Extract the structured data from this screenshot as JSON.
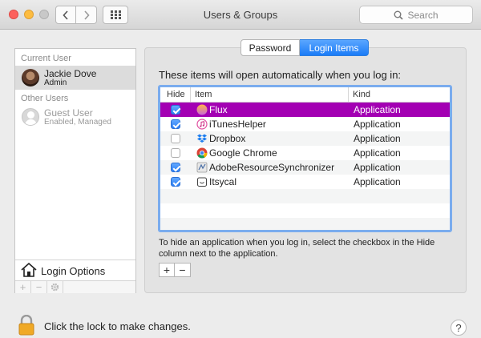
{
  "window": {
    "title": "Users & Groups"
  },
  "toolbar": {
    "search_placeholder": "Search"
  },
  "sidebar": {
    "current_user_label": "Current User",
    "current_user": {
      "name": "Jackie Dove",
      "role": "Admin"
    },
    "other_users_label": "Other Users",
    "other_users": [
      {
        "name": "Guest User",
        "role": "Enabled, Managed"
      }
    ],
    "login_options_label": "Login Options",
    "tools": [
      "+",
      "−",
      "gear-icon"
    ]
  },
  "tabs": [
    {
      "label": "Password",
      "active": false
    },
    {
      "label": "Login Items",
      "active": true
    }
  ],
  "main": {
    "intro": "These items will open automatically when you log in:",
    "columns": {
      "hide": "Hide",
      "item": "Item",
      "kind": "Kind"
    },
    "items": [
      {
        "name": "Flux",
        "kind": "Application",
        "hide": true,
        "selected": true,
        "icon": "flux-icon"
      },
      {
        "name": "iTunesHelper",
        "kind": "Application",
        "hide": true,
        "selected": false,
        "icon": "itunes-icon"
      },
      {
        "name": "Dropbox",
        "kind": "Application",
        "hide": false,
        "selected": false,
        "icon": "dropbox-icon"
      },
      {
        "name": "Google Chrome",
        "kind": "Application",
        "hide": false,
        "selected": false,
        "icon": "chrome-icon"
      },
      {
        "name": "AdobeResourceSynchronizer",
        "kind": "Application",
        "hide": true,
        "selected": false,
        "icon": "adobe-sync-icon"
      },
      {
        "name": "Itsycal",
        "kind": "Application",
        "hide": true,
        "selected": false,
        "icon": "itsycal-icon"
      }
    ],
    "hint": "To hide an application when you log in, select the checkbox in the Hide column next to the application.",
    "add_label": "+",
    "remove_label": "−"
  },
  "footer": {
    "lock_text": "Click the lock to make changes.",
    "help_label": "?"
  },
  "colors": {
    "selection": "#a300b3",
    "accent": "#2d80f5"
  }
}
